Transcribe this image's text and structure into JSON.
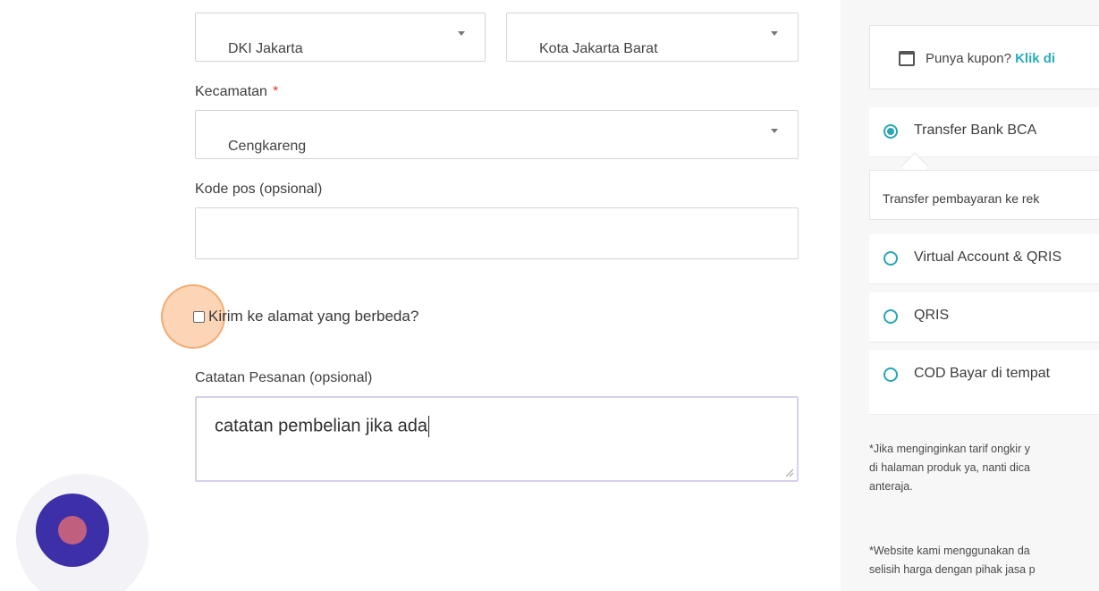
{
  "address": {
    "province_value": "DKI Jakarta",
    "city_value": "Kota Jakarta Barat",
    "district_label": "Kecamatan",
    "required_mark": "*",
    "district_value": "Cengkareng",
    "postcode_label": "Kode pos (opsional)",
    "postcode_value": ""
  },
  "ship_different": {
    "label": "Kirim ke alamat yang berbeda?",
    "checked": false
  },
  "order_notes": {
    "label": "Catatan Pesanan (opsional)",
    "value": "catatan pembelian jika ada"
  },
  "sidebar": {
    "coupon_text": "Punya kupon?",
    "coupon_link": "Klik di",
    "payment_methods": [
      {
        "label": "Transfer Bank BCA",
        "selected": true
      },
      {
        "label": "Virtual Account & QRIS",
        "selected": false
      },
      {
        "label": "QRIS",
        "selected": false
      },
      {
        "label": "COD Bayar di tempat",
        "selected": false
      }
    ],
    "payment_description": "Transfer pembayaran ke rek",
    "notes": [
      "*Jika menginginkan tarif ongkir y\ndi halaman produk ya, nanti dica\nanteraja.",
      "*Website kami menggunakan da\nselisih harga dengan pihak jasa p"
    ]
  },
  "colors": {
    "accent_teal": "#27aeb9",
    "fab_outer": "#3c2fa8",
    "fab_inner": "#c1607e",
    "required_red": "#e2401c"
  }
}
